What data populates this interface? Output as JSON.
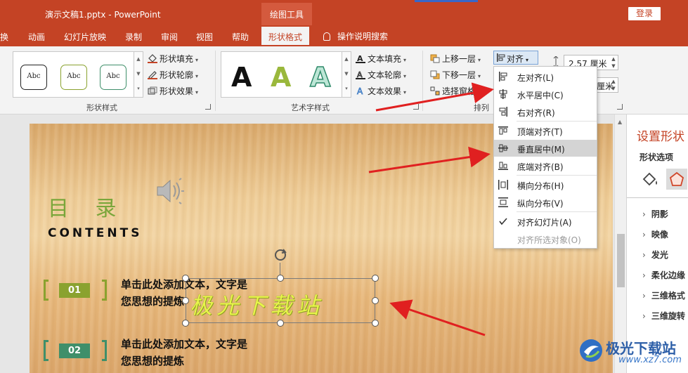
{
  "titlebar": {
    "doc_title": "演示文稿1.pptx  -  PowerPoint",
    "context_group": "绘图工具",
    "login": "登录"
  },
  "tabs": {
    "items": [
      "换",
      "动画",
      "幻灯片放映",
      "录制",
      "审阅",
      "视图",
      "帮助"
    ],
    "active": "形状格式",
    "search": "操作说明搜索"
  },
  "ribbon": {
    "shape_styles": {
      "label": "形状样式",
      "sample_text": "Abc",
      "fill": "形状填充",
      "outline": "形状轮廓",
      "effect": "形状效果"
    },
    "wordart": {
      "label": "艺术字样式",
      "letter": "A",
      "fill": "文本填充",
      "outline": "文本轮廓",
      "effect": "文本效果"
    },
    "arrange": {
      "label": "排列",
      "bring_forward": "上移一层",
      "send_backward": "下移一层",
      "selection_pane": "选择窗格",
      "align": "对齐"
    },
    "size": {
      "height": "2.57 厘米",
      "width_unit": "厘米"
    }
  },
  "align_menu": {
    "items": [
      {
        "label": "左对齐(L)",
        "icon": "align-left-icon"
      },
      {
        "label": "水平居中(C)",
        "icon": "align-center-icon"
      },
      {
        "label": "右对齐(R)",
        "icon": "align-right-icon"
      },
      {
        "label": "顶端对齐(T)",
        "icon": "align-top-icon"
      },
      {
        "label": "垂直居中(M)",
        "icon": "align-middle-icon"
      },
      {
        "label": "底端对齐(B)",
        "icon": "align-bottom-icon"
      },
      {
        "label": "横向分布(H)",
        "icon": "distribute-horizontal-icon"
      },
      {
        "label": "纵向分布(V)",
        "icon": "distribute-vertical-icon"
      },
      {
        "label": "对齐幻灯片(A)",
        "icon": "checkmark-icon"
      },
      {
        "label": "对齐所选对象(O)",
        "icon": ""
      }
    ],
    "hovered": "垂直居中(M)"
  },
  "slide": {
    "title": "目 录",
    "subtitle": "CONTENTS",
    "items": [
      {
        "num": "01",
        "line1": "单击此处添加文本，文字是",
        "line2": "您思想的提炼",
        "color": "#8aa22f"
      },
      {
        "num": "02",
        "line1": "单击此处添加文本，文字是",
        "line2": "您思想的提炼",
        "color": "#3f8f6a"
      }
    ],
    "wordart_text": "极光下载站"
  },
  "format_panel": {
    "title": "设置形状",
    "tab": "形状选项",
    "items": [
      "阴影",
      "映像",
      "发光",
      "柔化边缘",
      "三维格式",
      "三维旋转"
    ]
  },
  "watermark": {
    "name": "极光下载站",
    "url": "www.xz7.com"
  },
  "colors": {
    "accent": "#c44325",
    "arrow": "#e02020",
    "title_green": "#7aa63a"
  }
}
